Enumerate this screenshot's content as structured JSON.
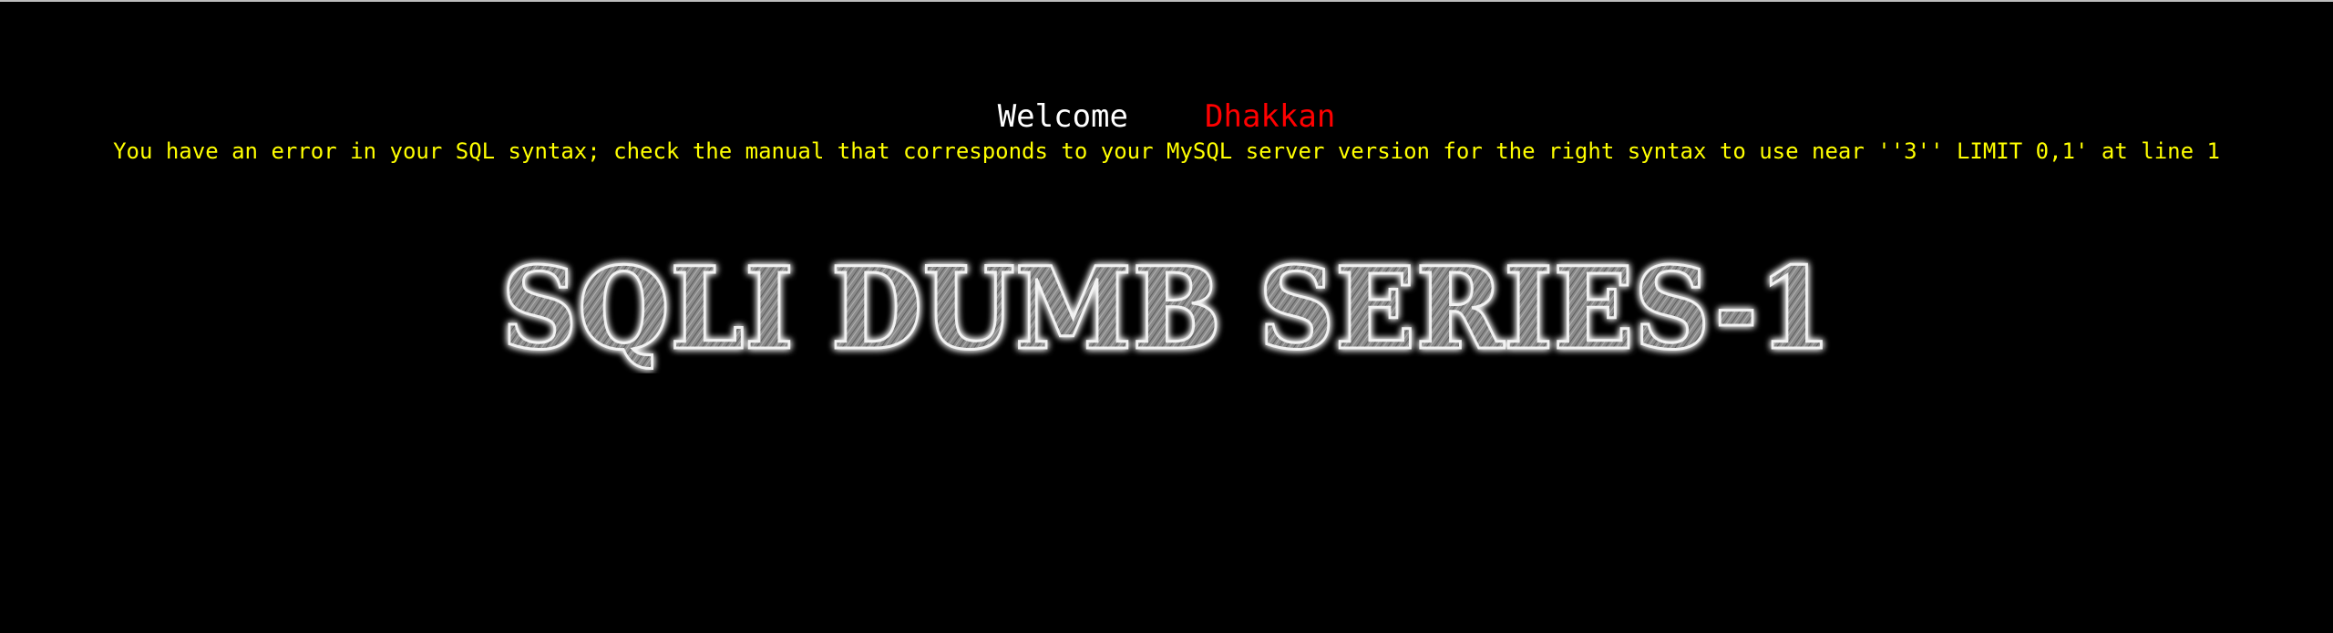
{
  "welcome": {
    "label": "Welcome",
    "name": "Dhakkan"
  },
  "error": {
    "message": "You have an error in your SQL syntax; check the manual that corresponds to your MySQL server version for the right syntax to use near ''3'' LIMIT 0,1' at line 1"
  },
  "logo": {
    "text": "SQLI DUMB SERIES-1"
  },
  "colors": {
    "background": "#000000",
    "welcome": "#ffffff",
    "name": "#ff0000",
    "error": "#ffff00",
    "logo_fill": "#8f8f8f",
    "logo_glow": "#ffffff"
  }
}
